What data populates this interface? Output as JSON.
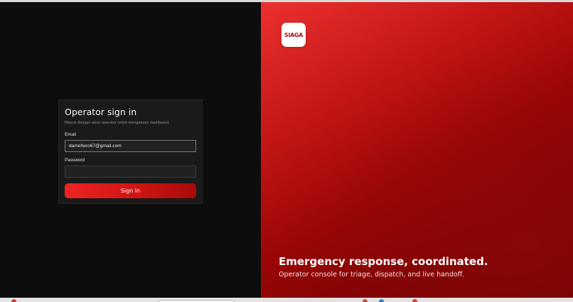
{
  "brand": {
    "logo_text": "SIAGA",
    "logo_color": "#b10d0d"
  },
  "hero": {
    "title": "Emergency response, coordinated.",
    "subtitle": "Operator console for triage, dispatch, and live handoff."
  },
  "signin": {
    "title": "Operator sign in",
    "subtitle": "Masuk dengan akun operator untuk mengakses dashboard.",
    "email_label": "Email",
    "email_value": "damehero67@gmail.com",
    "password_label": "Password",
    "password_value": "",
    "button_label": "Sign In"
  },
  "colors": {
    "accent": "#e21b1b",
    "panel_bg": "#1a1a1a",
    "page_bg": "#0d0d0d"
  },
  "taskbar": {
    "icons": [
      "app-icon-red",
      "app-icon-red",
      "app-icon-blue",
      "app-icon-red"
    ]
  }
}
